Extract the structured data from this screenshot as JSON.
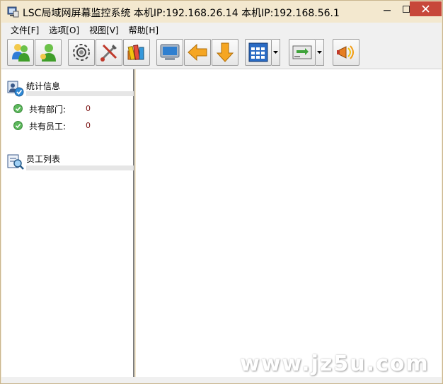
{
  "window": {
    "title": "LSC局域网屏幕监控系统    本机IP:192.168.26.14  本机IP:192.168.56.1",
    "minimize_label": "—",
    "close_label": "✕"
  },
  "menu": [
    "文件[F]",
    "选项[O]",
    "视图[V]",
    "帮助[H]"
  ],
  "toolbar": {
    "buttons": [
      {
        "icon": "users-icon"
      },
      {
        "icon": "user-icon"
      },
      {
        "icon": "gear-icon"
      },
      {
        "icon": "tools-icon"
      },
      {
        "icon": "books-icon"
      },
      {
        "icon": "monitor-icon"
      },
      {
        "icon": "arrow-left-icon"
      },
      {
        "icon": "arrow-down-icon"
      },
      {
        "icon": "grid-icon"
      },
      {
        "icon": "network-card-icon"
      },
      {
        "icon": "megaphone-icon"
      }
    ]
  },
  "stats": {
    "title": "统计信息",
    "items": [
      {
        "label": "共有部门:",
        "value": "0"
      },
      {
        "label": "共有员工:",
        "value": "0"
      }
    ]
  },
  "employees": {
    "title": "员工列表"
  },
  "watermark": "www.jz5u.com",
  "colors": {
    "title_bg": "#f3e8cf",
    "close_bg": "#c7473a",
    "value_red": "#7a1010"
  }
}
